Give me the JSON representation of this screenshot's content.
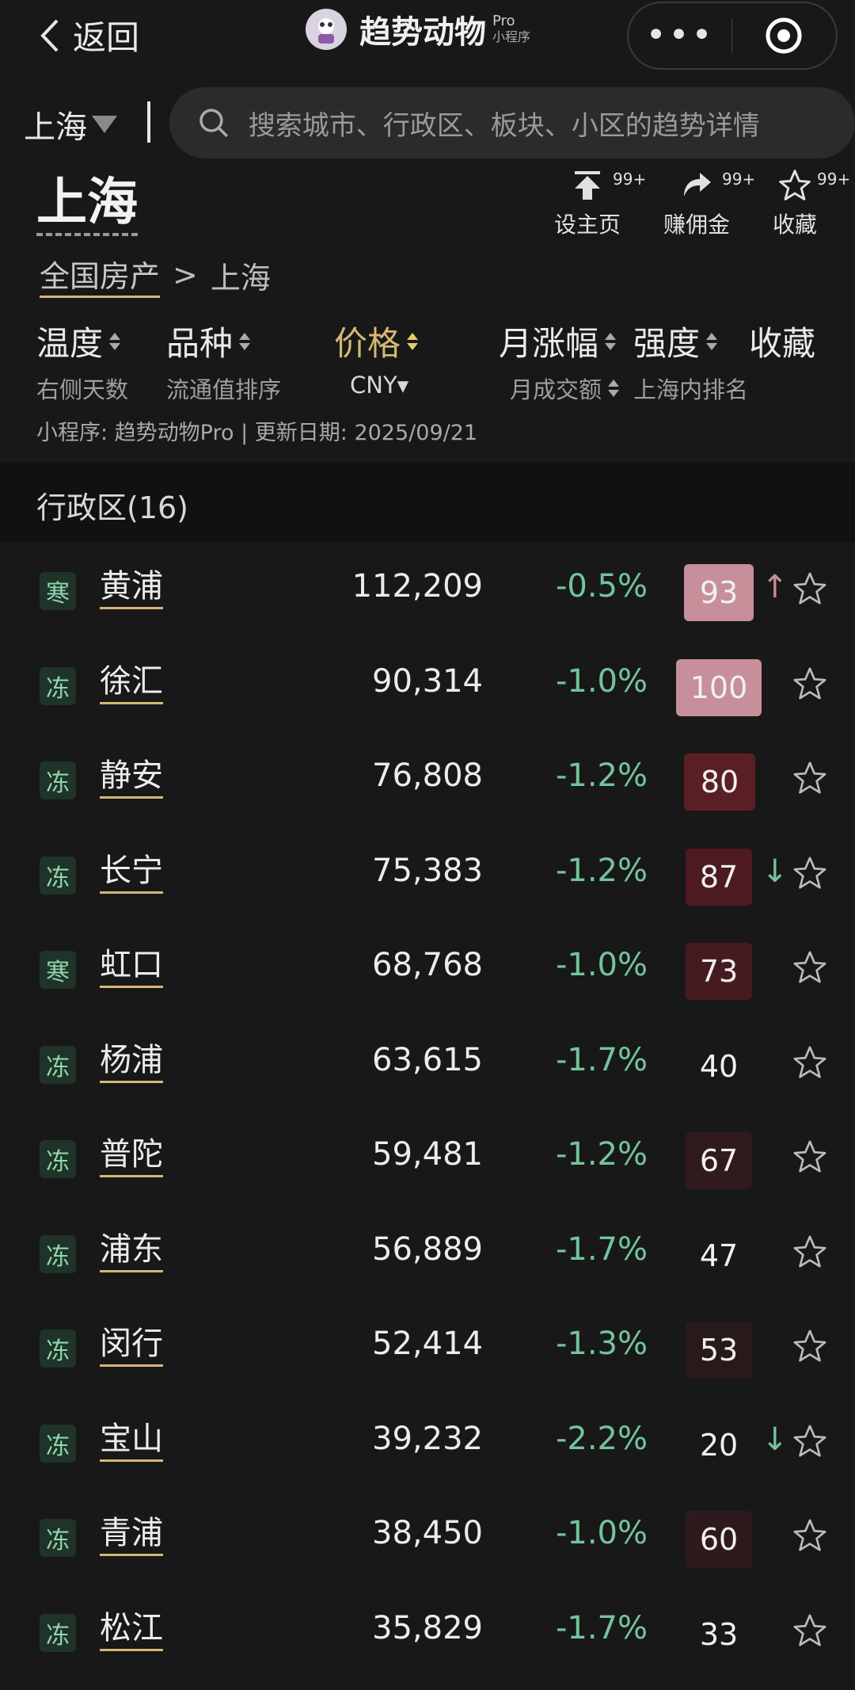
{
  "topbar": {
    "back_label": "返回",
    "app_name": "趋势动物",
    "app_pro": "Pro",
    "app_sub": "小程序",
    "more": "•••"
  },
  "search": {
    "city": "上海",
    "placeholder": "搜索城市、行政区、板块、小区的趋势详情"
  },
  "header": {
    "title": "上海",
    "actions": [
      {
        "label": "设主页",
        "badge": "99+",
        "icon": "pin-top-icon"
      },
      {
        "label": "赚佣金",
        "badge": "99+",
        "icon": "share-icon"
      },
      {
        "label": "收藏",
        "badge": "99+",
        "icon": "star-icon"
      }
    ],
    "breadcrumb": {
      "root": "全国房产",
      "sep": ">",
      "current": "上海"
    }
  },
  "columns": {
    "temp": {
      "title": "温度",
      "sub": "右侧天数"
    },
    "kind": {
      "title": "品种",
      "sub": "流通值排序"
    },
    "price": {
      "title": "价格",
      "sub": "CNY▾"
    },
    "change": {
      "title": "月涨幅",
      "sub": "月成交额"
    },
    "strength": {
      "title": "强度",
      "sub": "上海内排名"
    },
    "fav": {
      "title": "收藏"
    }
  },
  "meta": "小程序: 趋势动物Pro | 更新日期: 2025/09/21",
  "section": "行政区(16)",
  "colors": {
    "green": "#73c49b",
    "gold": "#d6b872",
    "pink": "#c68f99"
  },
  "rows": [
    {
      "tag": "寒",
      "name": "黄浦",
      "price": "112,209",
      "change": "-0.5%",
      "score": "93",
      "trend": "↑"
    },
    {
      "tag": "冻",
      "name": "徐汇",
      "price": "90,314",
      "change": "-1.0%",
      "score": "100",
      "trend": ""
    },
    {
      "tag": "冻",
      "name": "静安",
      "price": "76,808",
      "change": "-1.2%",
      "score": "80",
      "trend": ""
    },
    {
      "tag": "冻",
      "name": "长宁",
      "price": "75,383",
      "change": "-1.2%",
      "score": "87",
      "trend": "↓"
    },
    {
      "tag": "寒",
      "name": "虹口",
      "price": "68,768",
      "change": "-1.0%",
      "score": "73",
      "trend": ""
    },
    {
      "tag": "冻",
      "name": "杨浦",
      "price": "63,615",
      "change": "-1.7%",
      "score": "40",
      "trend": ""
    },
    {
      "tag": "冻",
      "name": "普陀",
      "price": "59,481",
      "change": "-1.2%",
      "score": "67",
      "trend": ""
    },
    {
      "tag": "冻",
      "name": "浦东",
      "price": "56,889",
      "change": "-1.7%",
      "score": "47",
      "trend": ""
    },
    {
      "tag": "冻",
      "name": "闵行",
      "price": "52,414",
      "change": "-1.3%",
      "score": "53",
      "trend": ""
    },
    {
      "tag": "冻",
      "name": "宝山",
      "price": "39,232",
      "change": "-2.2%",
      "score": "20",
      "trend": "↓"
    },
    {
      "tag": "冻",
      "name": "青浦",
      "price": "38,450",
      "change": "-1.0%",
      "score": "60",
      "trend": ""
    },
    {
      "tag": "冻",
      "name": "松江",
      "price": "35,829",
      "change": "-1.7%",
      "score": "33",
      "trend": ""
    }
  ]
}
